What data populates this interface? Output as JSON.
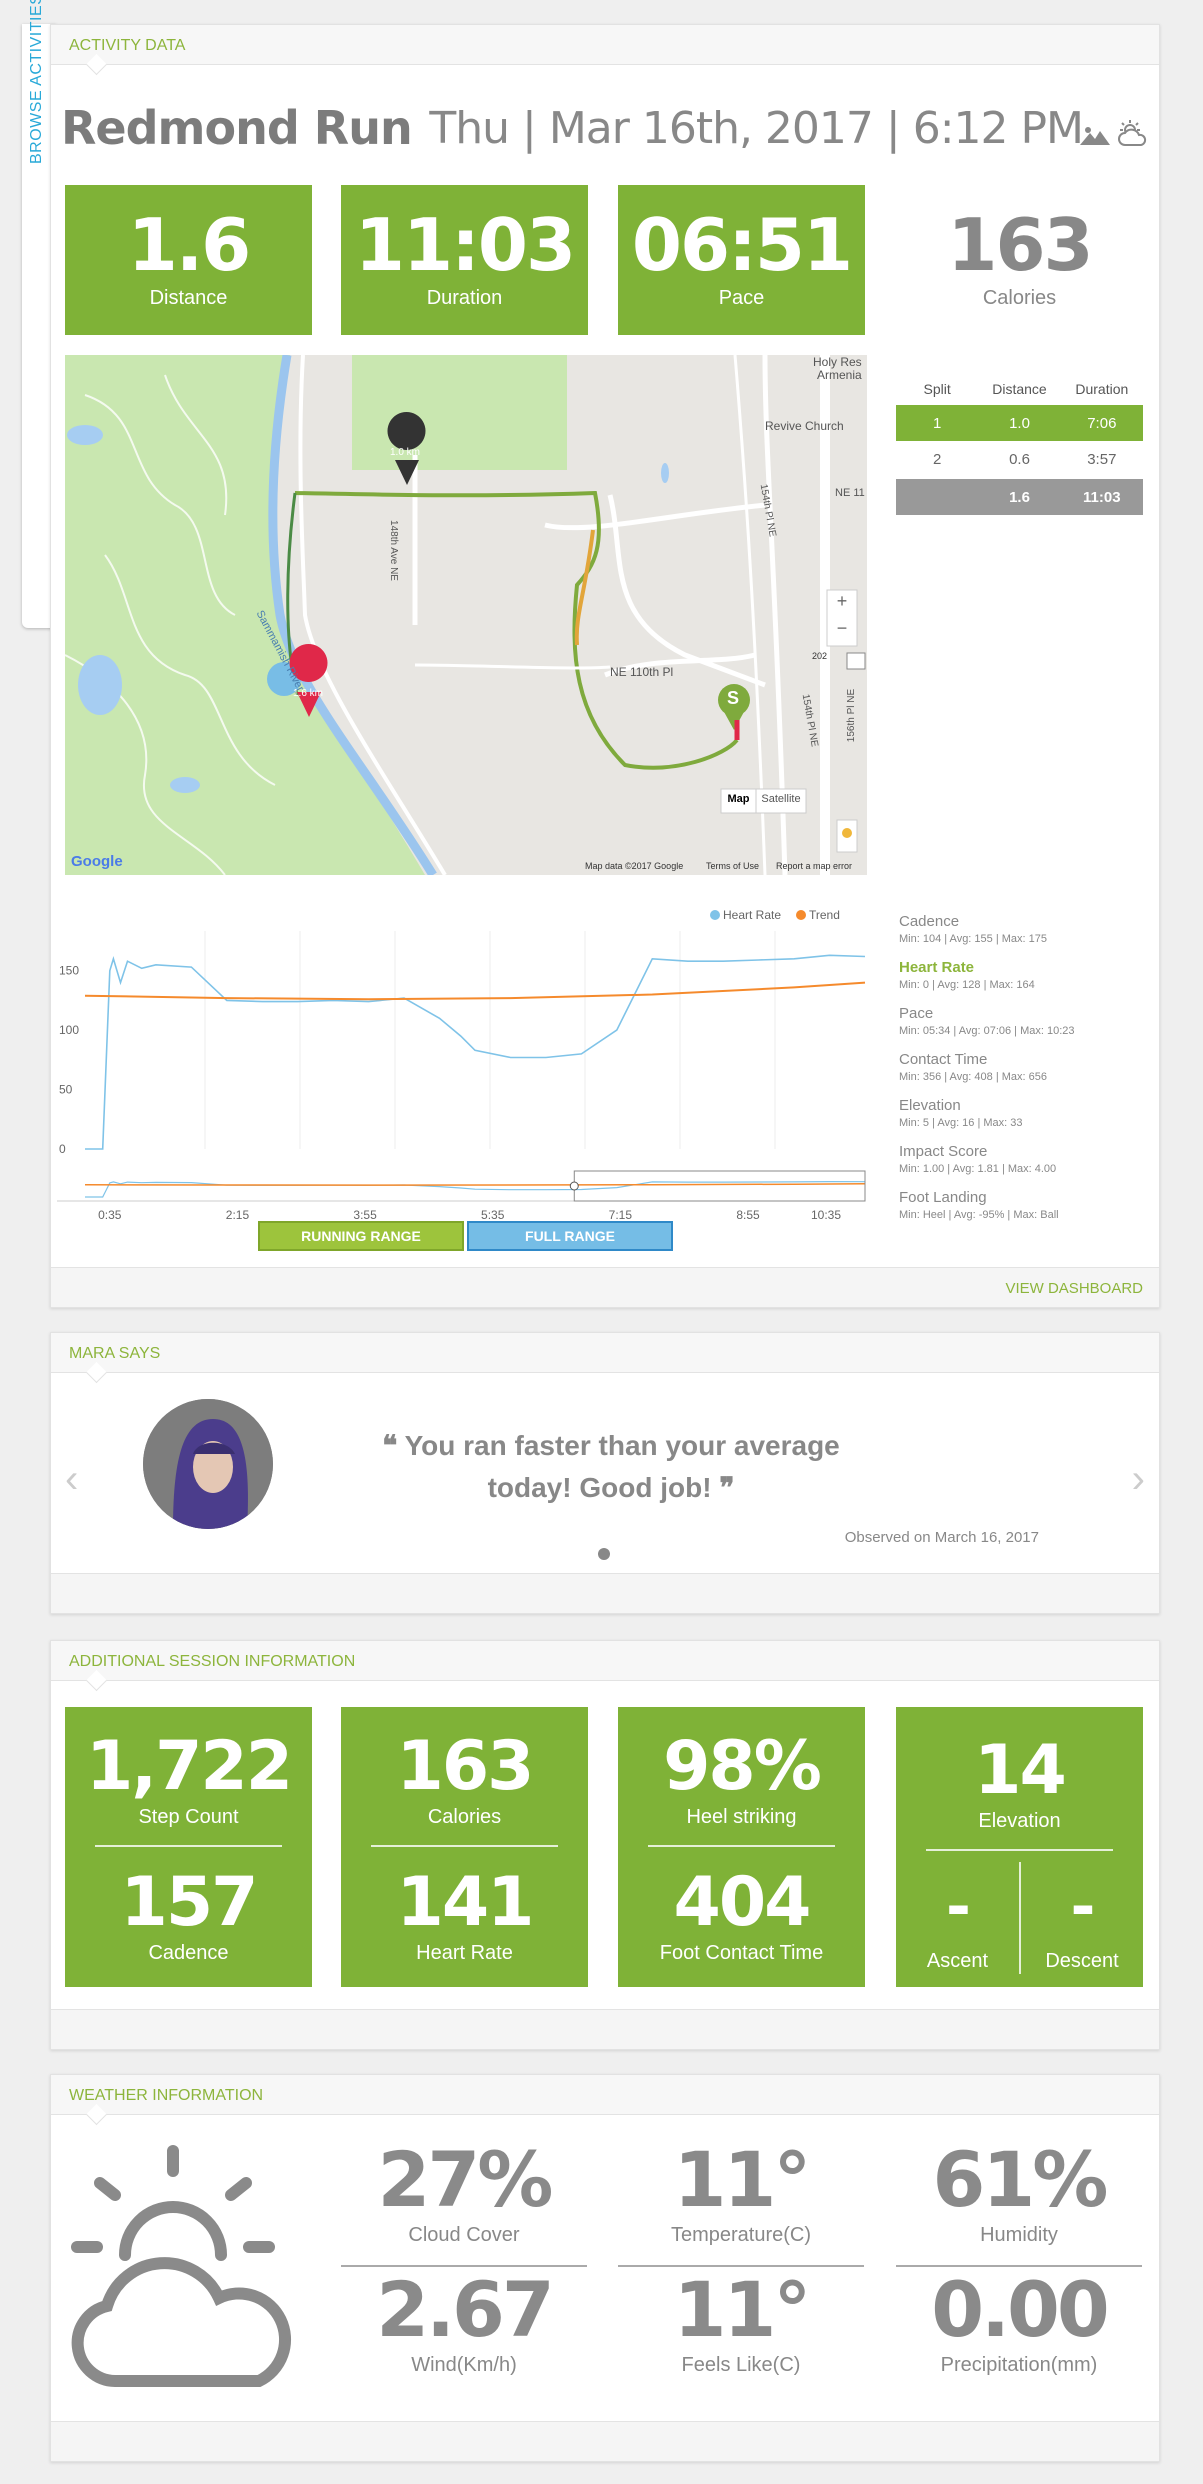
{
  "side_tab": "BROWSE ACTIVITIES",
  "activity": {
    "header": "ACTIVITY DATA",
    "title": "Redmond Run",
    "date": "Thu | Mar 16th, 2017 | 6:12 PM",
    "stats": [
      {
        "value": "1.6",
        "label": "Distance"
      },
      {
        "value": "11:03",
        "label": "Duration"
      },
      {
        "value": "06:51",
        "label": "Pace"
      },
      {
        "value": "163",
        "label": "Calories"
      }
    ],
    "map": {
      "labels": {
        "holy": "Holy Res",
        "armenia": "Armenia",
        "revive": "Revive Church",
        "ne11": "NE 11",
        "ave148": "148th Ave NE",
        "pl154": "154th Pl NE",
        "pl154b": "154th Pl NE",
        "pl156": "156th Pl NE",
        "ne110": "NE 110th Pl",
        "river": "Sammamish River",
        "route": "202",
        "marker1": "1.0 km",
        "marker2": "1.6 km",
        "start": "S",
        "map_btn": "Map",
        "sat_btn": "Satellite",
        "zoom_in": "+",
        "zoom_out": "−",
        "footer1": "Map data ©2017 Google",
        "footer2": "Terms of Use",
        "footer3": "Report a map error",
        "google": "Google"
      }
    },
    "splits": {
      "headers": [
        "Split",
        "Distance",
        "Duration"
      ],
      "rows": [
        [
          "1",
          "1.0",
          "7:06"
        ],
        [
          "2",
          "0.6",
          "3:57"
        ]
      ],
      "total": [
        "",
        "1.6",
        "11:03"
      ]
    },
    "metrics": [
      {
        "name": "Cadence",
        "stats": "Min: 104 | Avg: 155 | Max: 175"
      },
      {
        "name": "Heart Rate",
        "stats": "Min: 0 | Avg: 128 | Max: 164"
      },
      {
        "name": "Pace",
        "stats": "Min: 05:34 | Avg: 07:06 | Max: 10:23"
      },
      {
        "name": "Contact Time",
        "stats": "Min: 356 | Avg: 408 | Max: 656"
      },
      {
        "name": "Elevation",
        "stats": "Min: 5 | Avg: 16 | Max: 33"
      },
      {
        "name": "Impact Score",
        "stats": "Min: 1.00 | Avg: 1.81 | Max: 4.00"
      },
      {
        "name": "Foot Landing",
        "stats": "Min: Heel | Avg: -95% | Max: Ball"
      }
    ],
    "buttons": {
      "running": "RUNNING RANGE",
      "full": "FULL RANGE"
    },
    "view_dashboard": "VIEW DASHBOARD"
  },
  "chart_data": {
    "type": "line",
    "legend": [
      "Heart Rate",
      "Trend"
    ],
    "legend_position": "top-right",
    "colors": {
      "heart_rate": "#7fc3e8",
      "trend": "#f58a2c"
    },
    "y_ticks": [
      "150",
      "100",
      "50",
      "0"
    ],
    "ylim": [
      0,
      175
    ],
    "x_ticks": [
      "0:35",
      "2:15",
      "3:55",
      "5:35",
      "7:15",
      "8:55",
      "10:35"
    ],
    "series": [
      {
        "name": "Heart Rate",
        "x": [
          0,
          0.25,
          0.35,
          0.4,
          0.5,
          0.6,
          0.8,
          1.0,
          1.5,
          2.0,
          2.5,
          3.0,
          3.5,
          4.0,
          4.5,
          5.0,
          5.3,
          5.5,
          6.0,
          6.5,
          7.0,
          7.5,
          8.0,
          8.5,
          9.0,
          9.5,
          10.0,
          10.5,
          11.0
        ],
        "y": [
          0,
          0,
          150,
          160,
          140,
          158,
          152,
          155,
          153,
          125,
          124,
          124,
          125,
          124,
          127,
          110,
          95,
          83,
          77,
          77,
          80,
          100,
          160,
          158,
          158,
          159,
          160,
          163,
          162
        ]
      },
      {
        "name": "Trend",
        "x": [
          0,
          2,
          4,
          6,
          8,
          10,
          11
        ],
        "y": [
          129,
          127,
          126,
          127,
          130,
          136,
          140
        ]
      }
    ]
  },
  "mara": {
    "header": "MARA SAYS",
    "quote": "You ran faster than your average today! Good job!",
    "observed": "Observed on March 16, 2017"
  },
  "session": {
    "header": "ADDITIONAL SESSION INFORMATION",
    "cards": [
      {
        "top_value": "1,722",
        "top_label": "Step Count",
        "bottom_value": "157",
        "bottom_label": "Cadence"
      },
      {
        "top_value": "163",
        "top_label": "Calories",
        "bottom_value": "141",
        "bottom_label": "Heart Rate"
      },
      {
        "top_value": "98%",
        "top_label": "Heel striking",
        "bottom_value": "404",
        "bottom_label": "Foot Contact Time"
      }
    ],
    "elevation": {
      "value": "14",
      "label": "Elevation",
      "ascent_value": "-",
      "ascent_label": "Ascent",
      "descent_value": "-",
      "descent_label": "Descent"
    }
  },
  "weather": {
    "header": "WEATHER INFORMATION",
    "items": [
      {
        "value": "27%",
        "label": "Cloud Cover"
      },
      {
        "value": "11°",
        "label": "Temperature(C)"
      },
      {
        "value": "61%",
        "label": "Humidity"
      },
      {
        "value": "2.67",
        "label": "Wind(Km/h)"
      },
      {
        "value": "11°",
        "label": "Feels Like(C)"
      },
      {
        "value": "0.00",
        "label": "Precipitation(mm)"
      }
    ]
  }
}
